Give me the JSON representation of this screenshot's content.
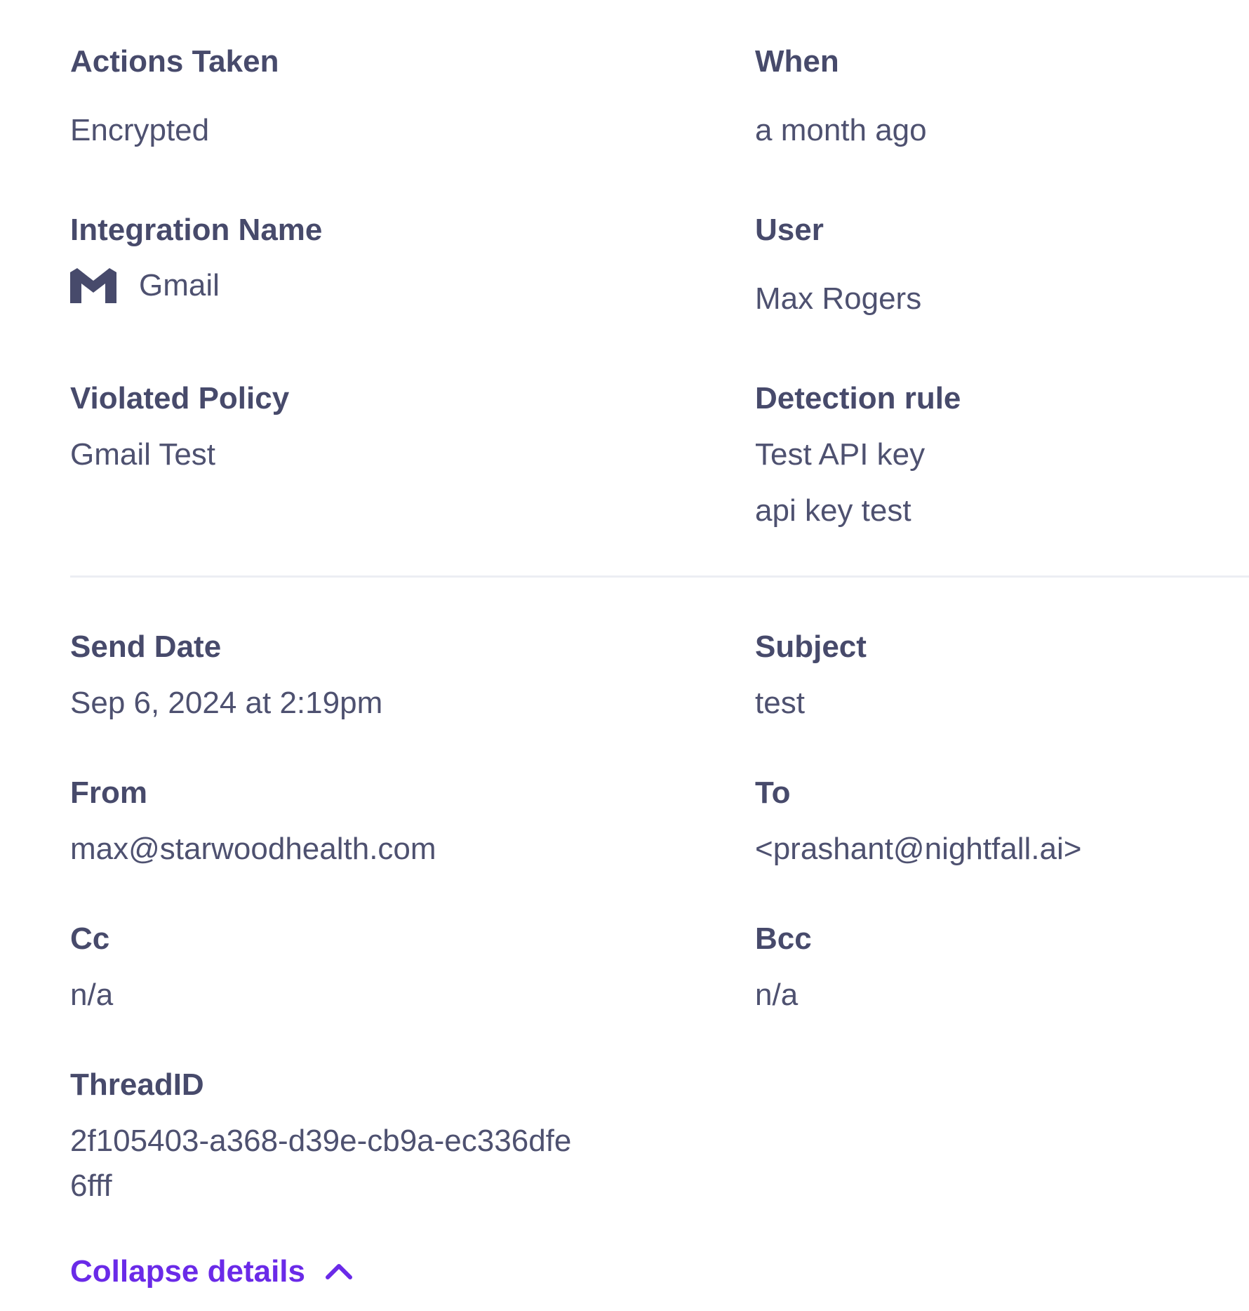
{
  "details": {
    "actions_taken": {
      "label": "Actions Taken",
      "value": "Encrypted"
    },
    "when": {
      "label": "When",
      "value": "a month ago"
    },
    "integration_name": {
      "label": "Integration Name",
      "value": "Gmail",
      "icon": "gmail-icon"
    },
    "user": {
      "label": "User",
      "value": "Max Rogers"
    },
    "violated_policy": {
      "label": "Violated Policy",
      "value": "Gmail Test"
    },
    "detection_rule": {
      "label": "Detection rule",
      "values": [
        "Test API key",
        "api key test"
      ]
    }
  },
  "email": {
    "send_date": {
      "label": "Send Date",
      "value": "Sep 6, 2024 at 2:19pm"
    },
    "subject": {
      "label": "Subject",
      "value": "test"
    },
    "from": {
      "label": "From",
      "value": "max@starwoodhealth.com"
    },
    "to": {
      "label": "To",
      "value": "<prashant@nightfall.ai>"
    },
    "cc": {
      "label": "Cc",
      "value": "n/a"
    },
    "bcc": {
      "label": "Bcc",
      "value": "n/a"
    },
    "thread_id": {
      "label": "ThreadID",
      "value_line1": "2f105403-a368-d39e-cb9a-ec336dfe",
      "value_line2": "6fff"
    }
  },
  "collapse": {
    "label": "Collapse details",
    "icon": "chevron-up-icon"
  },
  "colors": {
    "accent": "#6a2ae8",
    "label": "#474a6b",
    "value": "#4e5170",
    "divider": "#eceef3"
  }
}
